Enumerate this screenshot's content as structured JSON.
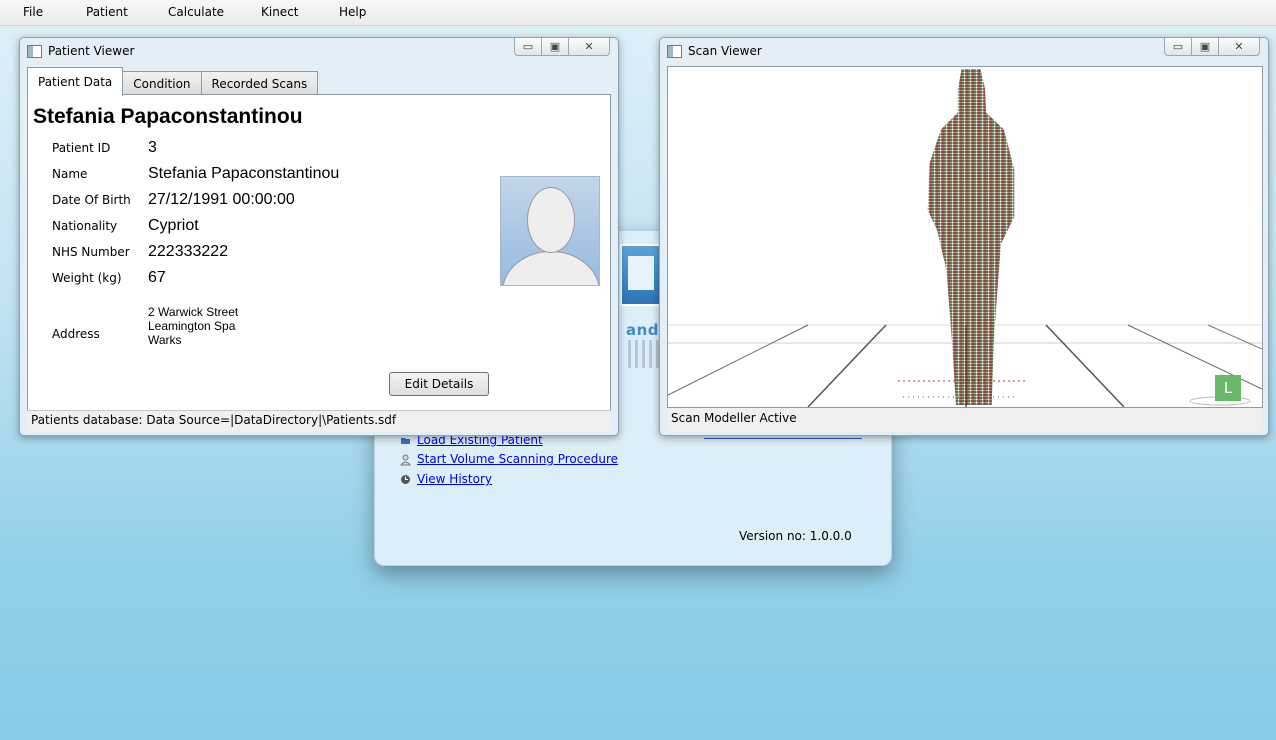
{
  "menu": [
    "File",
    "Patient",
    "Calculate",
    "Kinect",
    "Help"
  ],
  "launcher": {
    "logo_text": "and",
    "links": [
      {
        "label": "Load Existing Patient",
        "icon": "folder-icon"
      },
      {
        "label": "Start Volume Scanning Procedure",
        "icon": "person-icon"
      },
      {
        "label": "View History",
        "icon": "clock-icon"
      }
    ],
    "version": "Version no: 1.0.0.0"
  },
  "patient_viewer": {
    "title": "Patient Viewer",
    "tabs": [
      "Patient Data",
      "Condition",
      "Recorded Scans"
    ],
    "active_tab": "Patient Data",
    "patient_name": "Stefania Papaconstantinou",
    "fields": [
      {
        "label": "Patient ID",
        "value": "3"
      },
      {
        "label": "Name",
        "value": "Stefania Papaconstantinou"
      },
      {
        "label": "Date Of Birth",
        "value": "27/12/1991 00:00:00"
      },
      {
        "label": "Nationality",
        "value": "Cypriot"
      },
      {
        "label": "NHS Number",
        "value": "222333222"
      },
      {
        "label": "Weight (kg)",
        "value": "67"
      }
    ],
    "address_label": "Address",
    "address_lines": [
      "2 Warwick Street",
      "Leamington Spa",
      "Warks"
    ],
    "edit_button": "Edit Details",
    "status": "Patients database: Data Source=|DataDirectory|\\Patients.sdf"
  },
  "scan_viewer": {
    "title": "Scan Viewer",
    "status": "Scan Modeller Active",
    "badge": "L"
  },
  "caption_buttons": {
    "minimize": "▭",
    "maximize": "▣",
    "close": "✕"
  },
  "colors": {
    "desktop_top": "#dff0f8",
    "desktop_bottom": "#86cbe7",
    "link": "#0000ee",
    "badge": "#68b868"
  }
}
